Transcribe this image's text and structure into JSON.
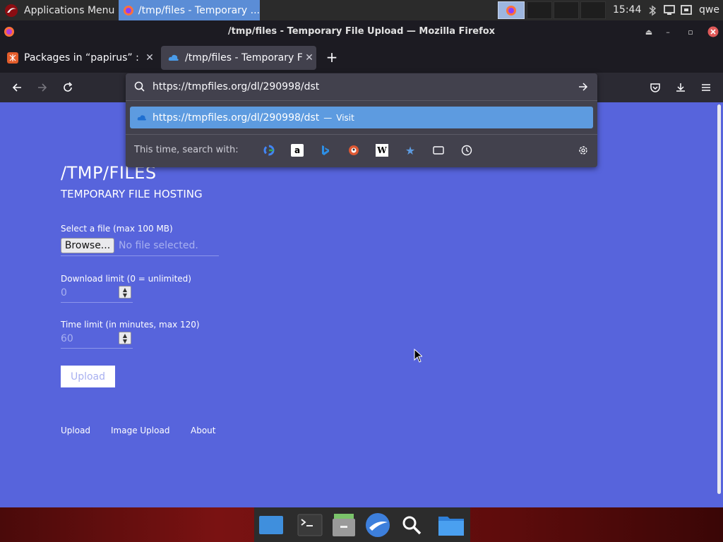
{
  "panel": {
    "app_menu_label": "Applications Menu",
    "task_label": "/tmp/files - Temporary ...",
    "clock": "15:44",
    "user": "qwe"
  },
  "window": {
    "title": "/tmp/files - Temporary File Upload — Mozilla Firefox"
  },
  "tabs": [
    {
      "label": "Packages in “papirus” : p",
      "active": false
    },
    {
      "label": "/tmp/files - Temporary Fil",
      "active": true
    }
  ],
  "urlbar": {
    "value": "https://tmpfiles.org/dl/290998/dst",
    "suggestion_url": "https://tmpfiles.org/dl/290998/dst",
    "suggestion_sep": "—",
    "suggestion_action": "Visit",
    "search_with_label": "This time, search with:",
    "engines": [
      "Google",
      "Amazon",
      "Bing",
      "DuckDuckGo",
      "Wikipedia",
      "Bookmarks",
      "Tabs",
      "History"
    ]
  },
  "page": {
    "site_title": "/TMP/FILES",
    "site_subtitle": "TEMPORARY FILE HOSTING",
    "file_label": "Select a file (max 100 MB)",
    "browse_label": "Browse...",
    "no_file_label": "No file selected.",
    "download_limit_label": "Download limit (0 = unlimited)",
    "download_limit_value": "0",
    "time_limit_label": "Time limit (in minutes, max 120)",
    "time_limit_value": "60",
    "upload_label": "Upload",
    "footer_links": [
      "Upload",
      "Image Upload",
      "About"
    ]
  },
  "colors": {
    "page_bg": "#5764dc",
    "accent": "#5d9be0",
    "panel_bg": "#2b2b2b"
  }
}
